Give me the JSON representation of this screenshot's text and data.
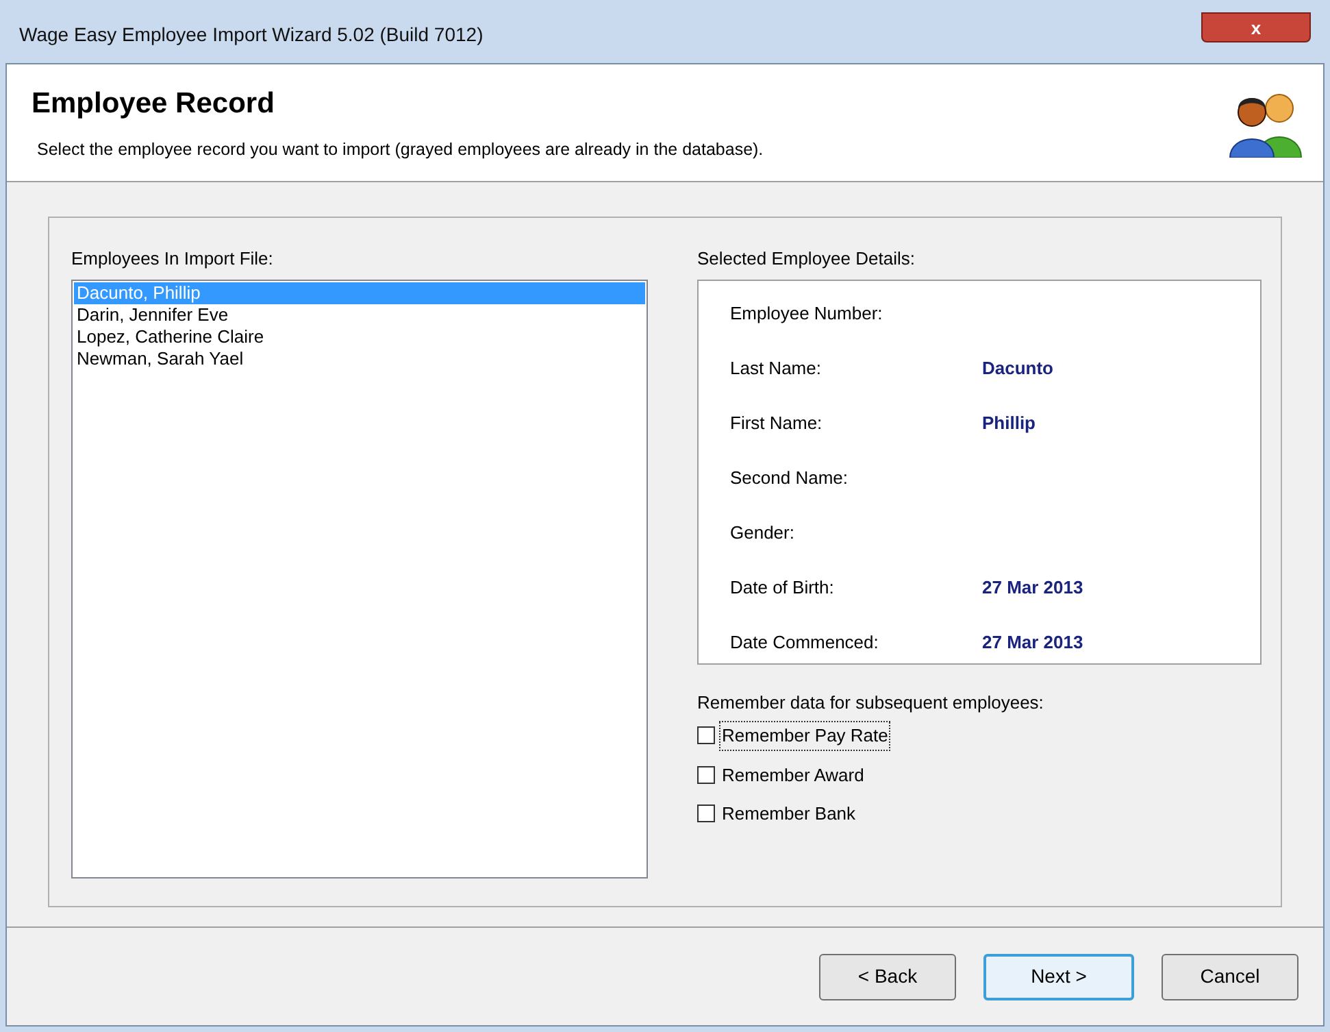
{
  "window": {
    "title": "Wage Easy Employee Import Wizard 5.02 (Build 7012)",
    "close": "x"
  },
  "header": {
    "title": "Employee Record",
    "subtitle": "Select the employee record you want to import (grayed employees are already in the database)."
  },
  "employees": {
    "label": "Employees In Import File:",
    "items": [
      {
        "name": "Dacunto, Phillip",
        "selected": true
      },
      {
        "name": "Darin, Jennifer Eve",
        "selected": false
      },
      {
        "name": "Lopez, Catherine Claire",
        "selected": false
      },
      {
        "name": "Newman, Sarah Yael",
        "selected": false
      }
    ]
  },
  "details": {
    "label": "Selected Employee Details:",
    "fields": [
      {
        "label": "Employee Number:"
      },
      {
        "label": "Last Name:",
        "value": "Dacunto"
      },
      {
        "label": "First Name:",
        "value": "Phillip"
      },
      {
        "label": "Second Name:"
      },
      {
        "label": "Gender:"
      },
      {
        "label": "Date of Birth:",
        "value": "27 Mar 2013"
      },
      {
        "label": "Date Commenced:",
        "value": "27 Mar 2013"
      }
    ]
  },
  "remember": {
    "label": "Remember data for subsequent employees:",
    "options": [
      {
        "label": "Remember Pay Rate",
        "checked": false,
        "focused": true
      },
      {
        "label": "Remember Award",
        "checked": false,
        "focused": false
      },
      {
        "label": "Remember Bank",
        "checked": false,
        "focused": false
      }
    ]
  },
  "buttons": [
    {
      "label": "< Back",
      "default": false
    },
    {
      "label": "Next >",
      "default": true
    },
    {
      "label": "Cancel",
      "default": false
    }
  ]
}
